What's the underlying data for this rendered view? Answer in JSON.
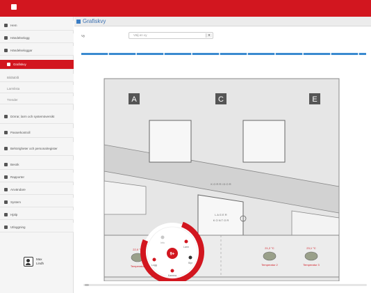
{
  "app": {
    "title": "Grafiskvy"
  },
  "sidebar": {
    "items": [
      {
        "label": "Hem",
        "icon": "home-icon",
        "sub": false,
        "active": false
      },
      {
        "label": "Händelselogg",
        "icon": "list-icon",
        "sub": false,
        "active": false
      },
      {
        "label": "Händelseloggar",
        "icon": "document-icon",
        "sub": false,
        "active": false
      },
      {
        "label": "Grafiskvy",
        "icon": "map-icon",
        "sub": true,
        "active": true
      },
      {
        "label": "Bildtablå",
        "icon": "",
        "sub": true,
        "active": false
      },
      {
        "label": "Larmlista",
        "icon": "",
        "sub": true,
        "active": false
      },
      {
        "label": "Trender",
        "icon": "",
        "sub": true,
        "active": false
      },
      {
        "label": "Dörrar, larm och systemöversikt",
        "icon": "lock-icon",
        "sub": false,
        "active": false
      },
      {
        "label": "Passerkontroll",
        "icon": "key-icon",
        "sub": false,
        "active": false
      },
      {
        "label": "Behörigheter och personalregister",
        "icon": "users-icon",
        "sub": false,
        "active": false
      },
      {
        "label": "Besök",
        "icon": "visitor-icon",
        "sub": false,
        "active": false
      },
      {
        "label": "Rapporter",
        "icon": "chart-icon",
        "sub": false,
        "active": false
      },
      {
        "label": "Användare",
        "icon": "user-icon",
        "sub": false,
        "active": false
      },
      {
        "label": "System",
        "icon": "gear-icon",
        "sub": false,
        "active": false
      },
      {
        "label": "Hjälp",
        "icon": "help-icon",
        "sub": false,
        "active": false
      },
      {
        "label": "Utloggning",
        "icon": "logout-icon",
        "sub": false,
        "active": false
      }
    ],
    "user": {
      "name": "Max Lindh",
      "icon": "avatar-icon"
    }
  },
  "filter": {
    "label": "Vy",
    "value": "Välj en vy",
    "chevron": "▾"
  },
  "map": {
    "rooms": [
      {
        "label": "A"
      },
      {
        "label": "C"
      },
      {
        "label": "E"
      }
    ],
    "corridor_label": "K O R R I D O R",
    "center_room_label": "L A G E R",
    "center_room_sub": "K O N T O R",
    "devices": [
      {
        "value": "22,0 °C",
        "name": "Temperatur"
      },
      {
        "value": "21,2 °C",
        "name": "Temperatur 2"
      },
      {
        "value": "23,1 °C",
        "name": "Temperatur 3"
      }
    ],
    "radial_menu": {
      "center": "9+",
      "items": [
        {
          "label": "Info"
        },
        {
          "label": "Larm"
        },
        {
          "label": "Styr"
        },
        {
          "label": "Kamera"
        },
        {
          "label": "Logg"
        }
      ]
    }
  },
  "colors": {
    "brand": "#d2161f",
    "accent": "#3a8ad0",
    "sidebar_bg": "#f5f5f5"
  }
}
